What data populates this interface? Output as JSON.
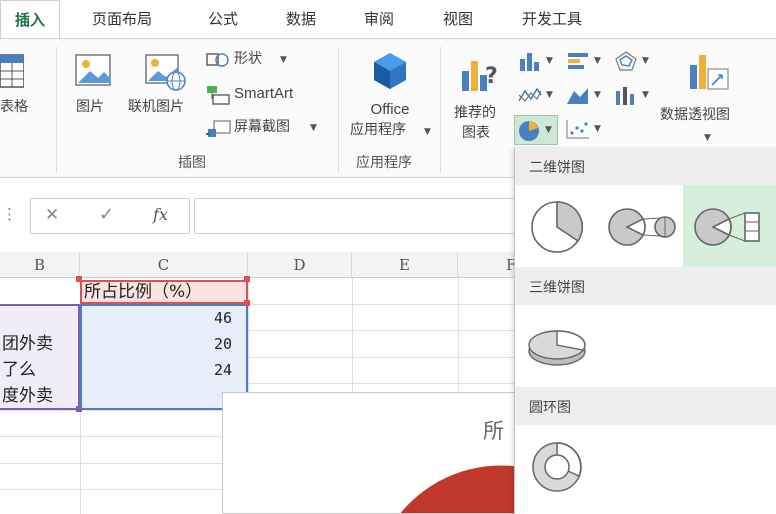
{
  "tabs": [
    {
      "label": "插入",
      "active": true
    },
    {
      "label": "页面布局"
    },
    {
      "label": "公式"
    },
    {
      "label": "数据"
    },
    {
      "label": "审阅"
    },
    {
      "label": "视图"
    },
    {
      "label": "开发工具"
    }
  ],
  "ribbon": {
    "table_label": "表格",
    "picture_label": "图片",
    "online_picture_label": "联机图片",
    "shapes_label": "形状",
    "smartart_label": "SmartArt",
    "screenshot_label": "屏幕截图",
    "illustrations_group": "插图",
    "office_line1": "Office",
    "office_line2": "应用程序",
    "apps_group": "应用程序",
    "recommended_line1": "推荐的",
    "recommended_line2": "图表",
    "pivot_chart_label": "数据透视图"
  },
  "formula_bar": {
    "cancel_glyph": "✕",
    "enter_glyph": "✓",
    "fx_label": "fx",
    "value": ""
  },
  "grid": {
    "columns": [
      "B",
      "C",
      "D",
      "E",
      "F"
    ],
    "header_cell": "所占比例（%）",
    "rows": [
      {
        "b": "",
        "c": "46"
      },
      {
        "b": "团外卖",
        "c": "20"
      },
      {
        "b": "了么",
        "c": "24"
      },
      {
        "b": "度外卖",
        "c": ""
      }
    ],
    "chart_title_partial": "所"
  },
  "dropdown": {
    "section_2d": "二维饼图",
    "section_3d": "三维饼图",
    "section_donut": "圆环图",
    "options_2d": [
      "pie",
      "pie-of-pie",
      "bar-of-pie"
    ],
    "options_3d": [
      "3d-pie"
    ],
    "options_donut": [
      "doughnut"
    ],
    "selected_option": "bar-of-pie"
  },
  "colors": {
    "accent_green": "#217346",
    "selection_purple": "#7b5fb3",
    "selection_red": "#d9534f",
    "selection_blue": "#4a7fc1",
    "chart_red": "#c0392b",
    "dropdown_selected_bg": "#d6efdd"
  }
}
